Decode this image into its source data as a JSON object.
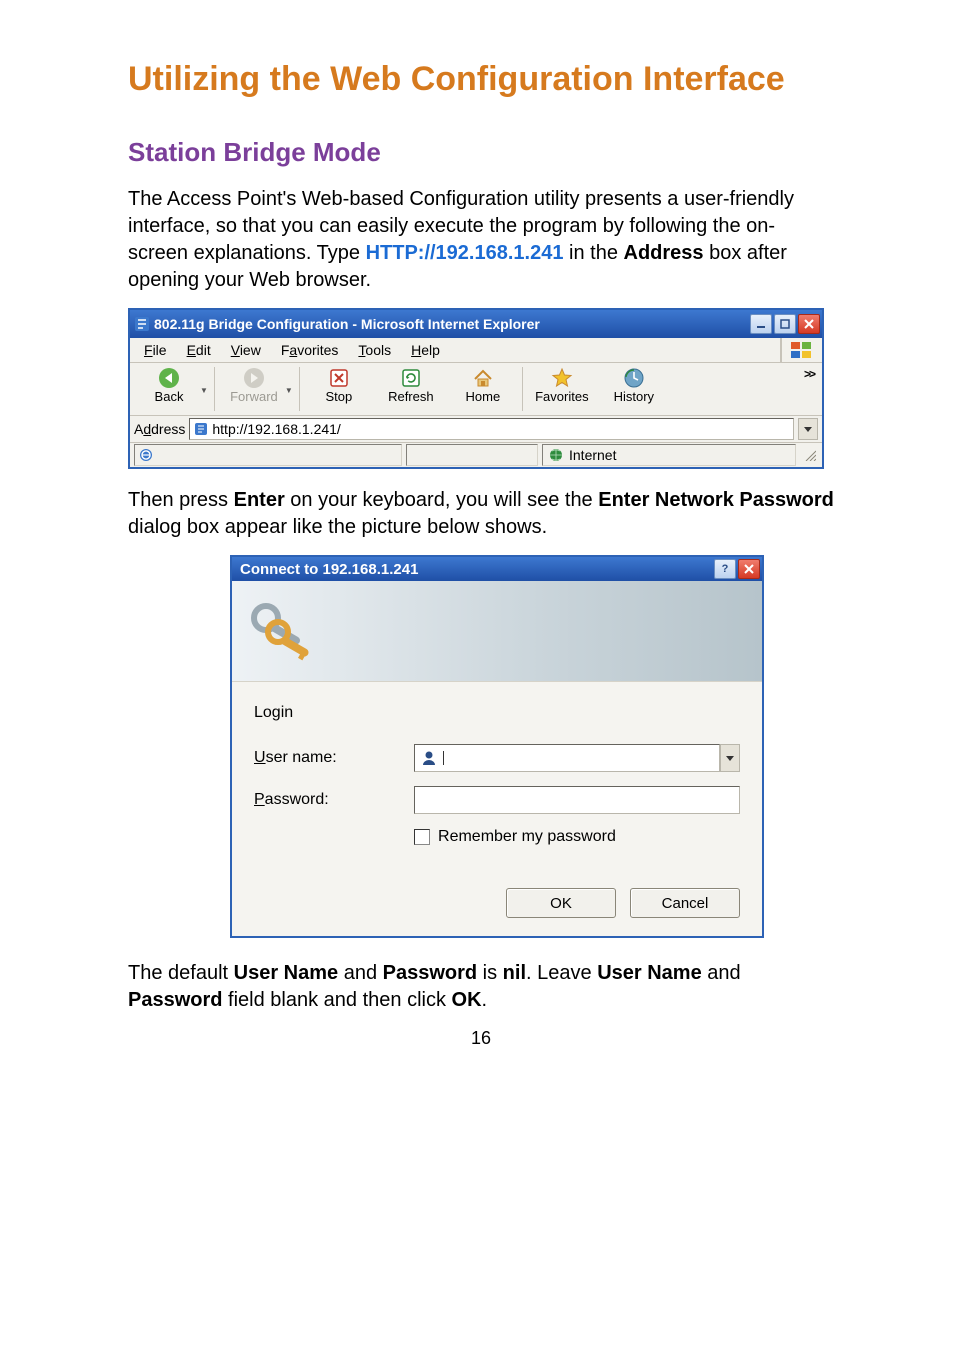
{
  "doc": {
    "title": "Utilizing the Web Configuration Interface",
    "section_title": "Station Bridge Mode",
    "intro_pre": "The Access Point's Web-based Configuration utility presents a user-friendly interface, so that you can easily execute the program by following the on-screen explanations. Type ",
    "intro_url": "HTTP://192.168.1.241",
    "intro_mid": " in the ",
    "intro_bold_address": "Address",
    "intro_post": " box after opening your Web browser.",
    "para2_pre": "Then press ",
    "para2_bold_enter": "Enter",
    "para2_mid": " on your keyboard, you will see the ",
    "para2_bold_dialog": "Enter Network Password",
    "para2_post": " dialog box appear like the picture below shows.",
    "para3_pre": "The default ",
    "para3_bold_un": "User Name",
    "para3_mid1": " and ",
    "para3_bold_pw": "Password",
    "para3_mid2": " is ",
    "para3_bold_nil": "nil",
    "para3_mid3": ". Leave ",
    "para3_bold_un2": "User Name",
    "para3_mid4": " and ",
    "para3_bold_pw2": "Password",
    "para3_mid5": " field blank and then click ",
    "para3_bold_ok": "OK",
    "para3_post": ".",
    "page_number": "16"
  },
  "ie": {
    "title": "802.11g Bridge Configuration - Microsoft Internet Explorer",
    "menu": {
      "file": {
        "u": "F",
        "rest": "ile"
      },
      "edit": {
        "u": "E",
        "rest": "dit"
      },
      "view": {
        "u": "V",
        "rest": "iew"
      },
      "favorites": {
        "pre": "F",
        "u": "a",
        "rest": "vorites"
      },
      "tools": {
        "u": "T",
        "rest": "ools"
      },
      "help": {
        "u": "H",
        "rest": "elp"
      }
    },
    "toolbar": {
      "back": "Back",
      "forward": "Forward",
      "stop": "Stop",
      "refresh": "Refresh",
      "home": "Home",
      "favorites": "Favorites",
      "history": "History",
      "overflow": ">>"
    },
    "address": {
      "label_pre": "A",
      "label_u": "d",
      "label_post": "dress",
      "url": "http://192.168.1.241/"
    },
    "status": {
      "zone": "Internet"
    }
  },
  "login": {
    "title": "Connect to 192.168.1.241",
    "realm": "Login",
    "username_label": {
      "u": "U",
      "rest": "ser name:"
    },
    "password_label": {
      "u": "P",
      "rest": "assword:"
    },
    "remember": {
      "u": "R",
      "rest": "emember my password"
    },
    "ok": "OK",
    "cancel": "Cancel",
    "username_value": "",
    "password_value": ""
  },
  "icons": {
    "ie_page": "ie-page-icon",
    "windows_flag": "windows-flag-icon",
    "back": "back-arrow-icon",
    "forward": "forward-arrow-icon",
    "stop": "stop-icon",
    "refresh": "refresh-icon",
    "home": "home-icon",
    "star": "star-icon",
    "history": "history-icon",
    "ie_e": "ie-e-icon",
    "globe": "globe-icon",
    "keys": "keys-icon",
    "user": "user-head-icon",
    "chevron_down": "chevron-down-icon"
  }
}
